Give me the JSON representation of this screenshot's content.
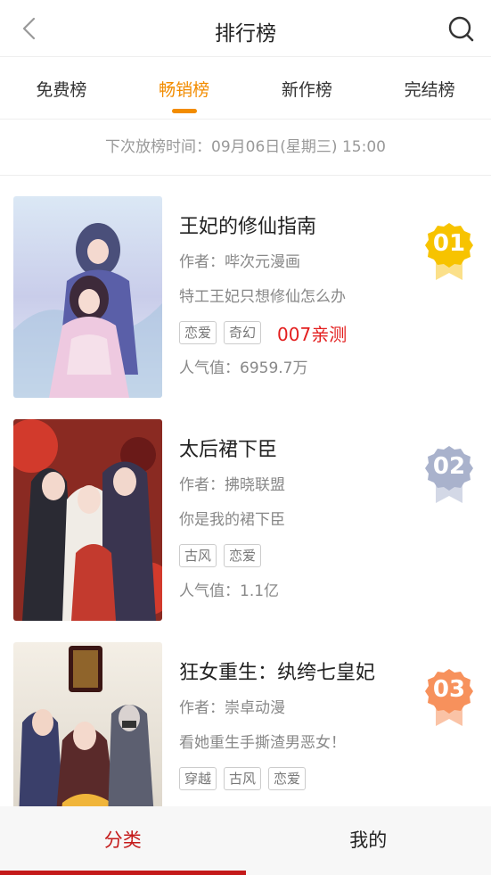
{
  "header": {
    "title": "排行榜",
    "back_icon": "chevron-left-icon",
    "search_icon": "search-icon"
  },
  "tabs": [
    {
      "label": "免费榜",
      "active": false
    },
    {
      "label": "畅销榜",
      "active": true
    },
    {
      "label": "新作榜",
      "active": false
    },
    {
      "label": "完结榜",
      "active": false
    }
  ],
  "notice": "下次放榜时间：09月06日(星期三) 15:00",
  "books": [
    {
      "rank": "01",
      "title": "王妃的修仙指南",
      "author": "作者：哔次元漫画",
      "description": "特工王妃只想修仙怎么办",
      "tags": [
        "恋爱",
        "奇幻"
      ],
      "promo": "007亲测",
      "popularity": "人气值：6959.7万",
      "rank_color": "#f7c300"
    },
    {
      "rank": "02",
      "title": "太后裙下臣",
      "author": "作者：拂晓联盟",
      "description": "你是我的裙下臣",
      "tags": [
        "古风",
        "恋爱"
      ],
      "promo": "",
      "popularity": "人气值：1.1亿",
      "rank_color": "#a9b2cc"
    },
    {
      "rank": "03",
      "title": "狂女重生：纨绔七皇妃",
      "author": "作者：崇卓动漫",
      "description": "看她重生手撕渣男恶女！",
      "tags": [
        "穿越",
        "古风",
        "恋爱"
      ],
      "promo": "",
      "popularity": "",
      "rank_color": "#f7915c"
    }
  ],
  "bottom_nav": [
    {
      "label": "分类",
      "active": true
    },
    {
      "label": "我的",
      "active": false
    }
  ],
  "colors": {
    "accent_tab": "#f28c00",
    "bottom_active": "#c41a1a",
    "promo": "#e31e1e"
  }
}
